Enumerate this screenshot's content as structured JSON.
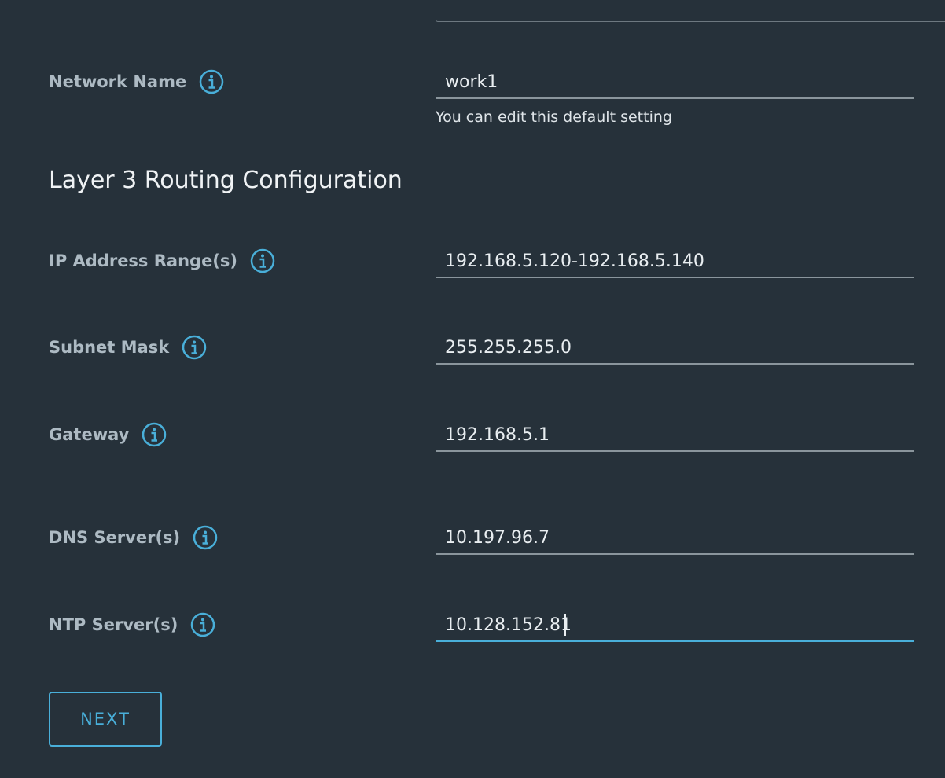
{
  "form": {
    "network_name": {
      "label": "Network Name",
      "value": "work1",
      "helper": "You can edit this default setting"
    },
    "section_title": "Layer 3 Routing Configuration",
    "ip_range": {
      "label": "IP Address Range(s)",
      "value": "192.168.5.120-192.168.5.140"
    },
    "subnet_mask": {
      "label": "Subnet Mask",
      "value": "255.255.255.0"
    },
    "gateway": {
      "label": "Gateway",
      "value": "192.168.5.1"
    },
    "dns": {
      "label": "DNS Server(s)",
      "value": "10.197.96.7"
    },
    "ntp": {
      "label": "NTP Server(s)",
      "value": "10.128.152.81"
    },
    "next_label": "NEXT"
  },
  "icons": {
    "info": "info-circle-icon"
  },
  "colors": {
    "background": "#26313a",
    "accent": "#49afd9",
    "label": "#adbac3",
    "text": "#e9eef1"
  }
}
